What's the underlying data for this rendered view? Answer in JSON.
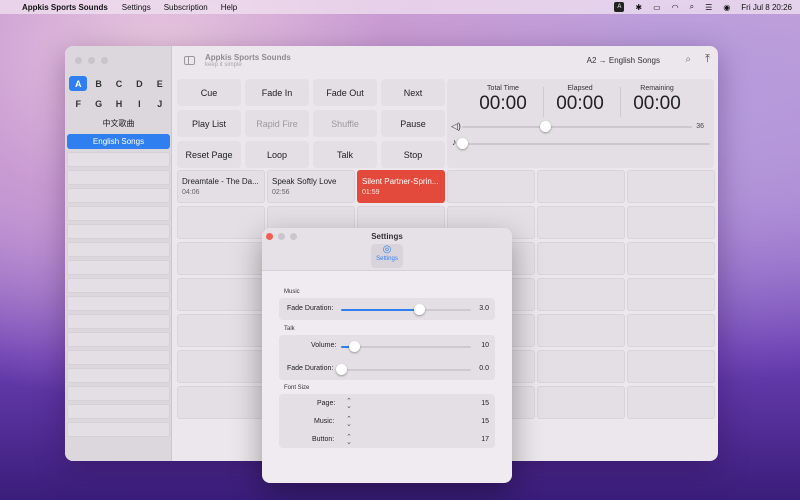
{
  "menubar": {
    "app_name": "Appkis Sports Sounds",
    "items": [
      "Settings",
      "Subscription",
      "Help"
    ],
    "clock": "Fri Jul 8  20:26",
    "keyboard_badge": "A"
  },
  "window": {
    "title": "Appkis Sports Sounds",
    "subtitle": "keep it simple",
    "breadcrumb": "A2 → English Songs"
  },
  "sidebar": {
    "letters": [
      "A",
      "B",
      "C",
      "D",
      "E",
      "F",
      "G",
      "H",
      "I",
      "J"
    ],
    "active_letter": "A",
    "pages": [
      {
        "label": "中文歌曲"
      },
      {
        "label": "English Songs",
        "selected": true
      }
    ]
  },
  "buttons": [
    {
      "label": "Cue"
    },
    {
      "label": "Fade In"
    },
    {
      "label": "Fade Out"
    },
    {
      "label": "Next"
    },
    {
      "label": "Play List"
    },
    {
      "label": "Rapid Fire",
      "disabled": true
    },
    {
      "label": "Shuffle",
      "disabled": true
    },
    {
      "label": "Pause"
    },
    {
      "label": "Reset Page"
    },
    {
      "label": "Loop"
    },
    {
      "label": "Talk"
    },
    {
      "label": "Stop"
    }
  ],
  "timers": {
    "total_label": "Total Time",
    "total_value": "00:00",
    "elapsed_label": "Elapsed",
    "elapsed_value": "00:00",
    "remaining_label": "Remaining",
    "remaining_value": "00:00",
    "volume_value": "36",
    "volume_fraction": 0.36,
    "progress_fraction": 0.0
  },
  "songs": [
    {
      "title": "Dreamtale - The Da...",
      "duration": "04:06"
    },
    {
      "title": "Speak Softly Love",
      "duration": "02:56"
    },
    {
      "title": "Silent Partner-Sprin...",
      "duration": "01:59",
      "playing": true
    }
  ],
  "settings": {
    "title": "Settings",
    "tab_label": "Settings",
    "music": {
      "section": "Music",
      "fade_label": "Fade Duration:",
      "fade_value": "3.0",
      "fade_fraction": 0.6
    },
    "talk": {
      "section": "Talk",
      "volume_label": "Volume:",
      "volume_value": "10",
      "volume_fraction": 0.1,
      "fade_label": "Fade Duration:",
      "fade_value": "0.0",
      "fade_fraction": 0.0
    },
    "font_size": {
      "section": "Font Size",
      "page_label": "Page:",
      "page_value": "15",
      "music_label": "Music:",
      "music_value": "15",
      "button_label": "Button:",
      "button_value": "17"
    }
  },
  "colors": {
    "accent": "#2f7ff0",
    "playing": "#e34a3b"
  }
}
